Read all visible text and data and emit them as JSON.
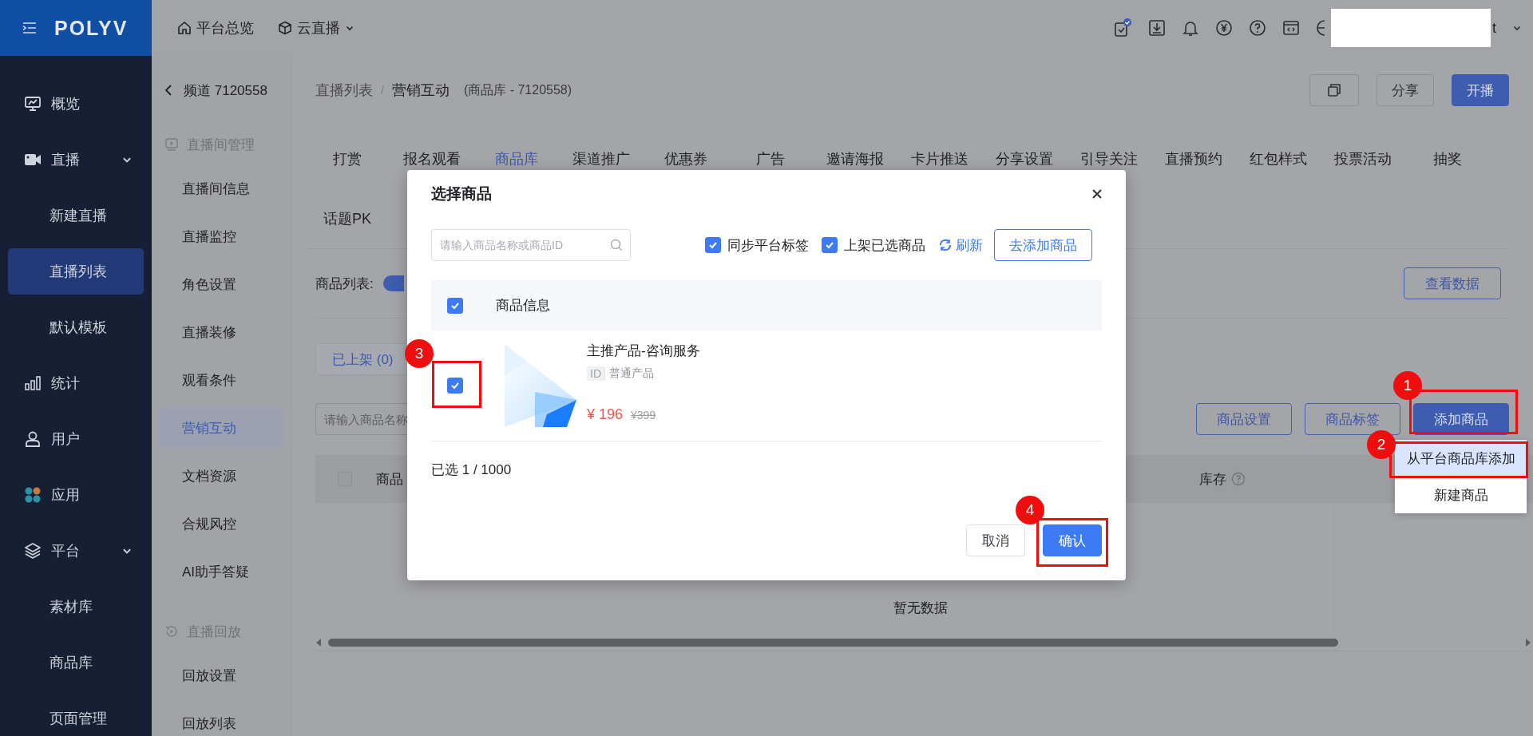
{
  "top_bar": {
    "logo": "POLYV",
    "nav": [
      {
        "label": "平台总览",
        "kind": "home",
        "has_menu": false
      },
      {
        "label": "云直播",
        "kind": "cube",
        "has_menu": true
      }
    ],
    "user_name": "t"
  },
  "sidebar": {
    "items": [
      {
        "label": "概览",
        "kind": "monitor",
        "selected": false
      },
      {
        "label": "直播",
        "kind": "video",
        "expanded": true,
        "children": [
          {
            "label": "新建直播",
            "selected": false
          },
          {
            "label": "直播列表",
            "selected": true
          },
          {
            "label": "默认模板",
            "selected": false
          }
        ]
      },
      {
        "label": "统计",
        "kind": "chart",
        "selected": false
      },
      {
        "label": "用户",
        "kind": "user",
        "selected": false
      },
      {
        "label": "应用",
        "kind": "apps",
        "selected": false
      },
      {
        "label": "平台",
        "kind": "layers",
        "expanded": true,
        "children": [
          {
            "label": "素材库",
            "selected": false
          },
          {
            "label": "商品库",
            "selected": false
          },
          {
            "label": "页面管理",
            "selected": false
          }
        ]
      }
    ]
  },
  "subnav": {
    "back_label": "频道 7120558",
    "sections": [
      {
        "title": "直播间管理",
        "kind": "play",
        "items": [
          {
            "label": "直播间信息",
            "selected": false
          },
          {
            "label": "直播监控",
            "selected": false
          },
          {
            "label": "角色设置",
            "selected": false
          },
          {
            "label": "直播装修",
            "selected": false
          },
          {
            "label": "观看条件",
            "selected": false
          },
          {
            "label": "营销互动",
            "selected": true
          },
          {
            "label": "文档资源",
            "selected": false
          },
          {
            "label": "合规风控",
            "selected": false
          },
          {
            "label": "AI助手答疑",
            "selected": false
          }
        ]
      },
      {
        "title": "直播回放",
        "kind": "replay",
        "items": [
          {
            "label": "回放设置",
            "selected": false
          },
          {
            "label": "回放列表",
            "selected": false
          }
        ]
      }
    ]
  },
  "breadcrumb": {
    "items": [
      "直播列表",
      "营销互动"
    ],
    "separator": "/",
    "note": "(商品库 - 7120558)"
  },
  "header_buttons": [
    {
      "kind": "icon"
    },
    {
      "label": "分享",
      "kind": "default"
    },
    {
      "label": "开播",
      "kind": "primary"
    }
  ],
  "tabs": [
    {
      "label": "打赏",
      "selected": false
    },
    {
      "label": "报名观看",
      "selected": false
    },
    {
      "label": "商品库",
      "selected": true
    },
    {
      "label": "渠道推广",
      "selected": false
    },
    {
      "label": "优惠券",
      "selected": false
    },
    {
      "label": "广告",
      "selected": false
    },
    {
      "label": "邀请海报",
      "selected": false
    },
    {
      "label": "卡片推送",
      "selected": false
    },
    {
      "label": "分享设置",
      "selected": false
    },
    {
      "label": "引导关注",
      "selected": false
    },
    {
      "label": "直播预约",
      "selected": false
    },
    {
      "label": "红包样式",
      "selected": false
    },
    {
      "label": "投票活动",
      "selected": false
    },
    {
      "label": "抽奖",
      "selected": false
    },
    {
      "label": "话题PK",
      "selected": false
    }
  ],
  "product_list": {
    "label": "商品列表:",
    "toggle_on": true,
    "view_data_button": "查看数据",
    "status_tabs": [
      {
        "label": "已上架 (0)",
        "selected": true
      }
    ],
    "search_placeholder": "请输入商品名称",
    "action_buttons": [
      {
        "label": "商品设置",
        "kind": "outline"
      },
      {
        "label": "商品标签",
        "kind": "outline"
      },
      {
        "label": "添加商品",
        "kind": "primary"
      }
    ],
    "table": {
      "header_checked": false,
      "columns": [
        {
          "label": "商品",
          "help": false
        },
        {
          "label": "库存",
          "help": true
        }
      ],
      "empty_text": "暂无数据"
    }
  },
  "add_menu": {
    "items": [
      {
        "label": "从平台商品库添加",
        "selected": true
      },
      {
        "label": "新建商品",
        "selected": false
      }
    ]
  },
  "dialog": {
    "title": "选择商品",
    "search_placeholder": "请输入商品名称或商品ID",
    "options": [
      {
        "label": "同步平台标签",
        "checked": true
      },
      {
        "label": "上架已选商品",
        "checked": true
      }
    ],
    "refresh_label": "刷新",
    "add_button": "去添加商品",
    "header_checked": true,
    "header_label": "商品信息",
    "products": [
      {
        "name": "主推产品-咨询服务",
        "checked": true,
        "tag": "ID",
        "type": "普通产品",
        "price": "¥ 196",
        "original_price": "¥399",
        "kind": "picture"
      }
    ],
    "selected_count": "已选 1 / 1000",
    "buttons": [
      {
        "label": "取消",
        "kind": "default"
      },
      {
        "label": "确认",
        "kind": "primary"
      }
    ]
  },
  "annotations": [
    {
      "number": "1"
    },
    {
      "number": "2"
    },
    {
      "number": "3"
    },
    {
      "number": "4"
    }
  ]
}
